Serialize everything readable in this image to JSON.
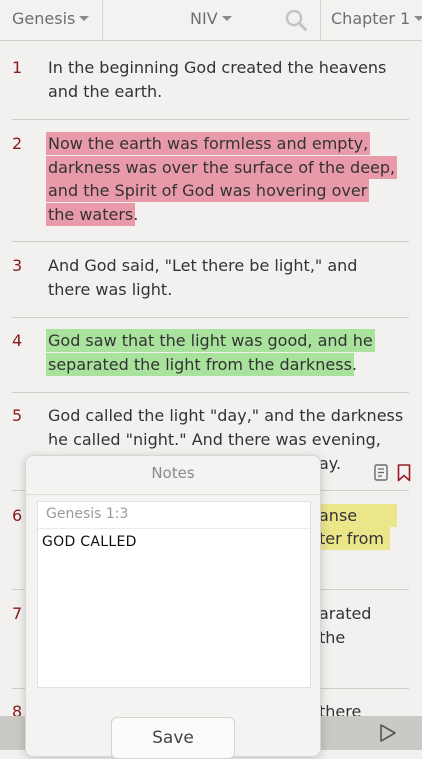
{
  "toolbar": {
    "book": "Genesis",
    "version": "NIV",
    "chapter": "Chapter 1"
  },
  "verses": [
    {
      "num": "1",
      "text": "In the beginning God created the heavens and the earth.",
      "highlight": "none"
    },
    {
      "num": "2",
      "text": "Now the earth was formless and empty, darkness was over the surface of the deep, and the Spirit of God was hovering over the waters",
      "tail": ".",
      "highlight": "red"
    },
    {
      "num": "3",
      "text": "And God said, \"Let there be light,\" and there was light.",
      "highlight": "none"
    },
    {
      "num": "4",
      "text": "God saw that the light was good, and he separated the light from the darkness",
      "tail": ".",
      "highlight": "green"
    },
    {
      "num": "5",
      "line1": "God called the light \"day,\" and the darkness",
      "line2": "he called \"night.\" And there was evening,",
      "line3_visible": "ay.",
      "highlight": "none"
    },
    {
      "num": "6",
      "line1_visible": "anse",
      "line2_visible": "ter from",
      "highlight": "yellow"
    },
    {
      "num": "7",
      "line1_visible": "arated",
      "line2_visible": "the",
      "highlight": "none"
    },
    {
      "num": "8",
      "line1_visible": "there",
      "highlight": "none"
    }
  ],
  "notes_popover": {
    "title": "Notes",
    "reference": "Genesis  1:3",
    "note_text": "GOD CALLED",
    "save_label": "Save"
  },
  "colors": {
    "highlight_red": "#e99aa8",
    "highlight_green": "#a8e29d",
    "highlight_yellow": "#ece68b",
    "verse_number": "#8b1a1a"
  },
  "icons": [
    "search-icon",
    "note-icon",
    "bookmark-icon",
    "play-icon",
    "chevron-down-icon"
  ]
}
